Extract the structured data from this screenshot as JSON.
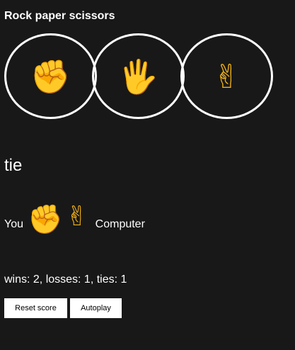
{
  "app": {
    "title": "Rock paper scissors"
  },
  "moves": {
    "rock_icon": "✊",
    "paper_icon": "🖐",
    "scissors_icon": "✌"
  },
  "result": {
    "text": "tie"
  },
  "round": {
    "player_label": "You",
    "player_move_icon": "✊",
    "computer_move_icon": "✌",
    "computer_label": "Computer"
  },
  "score": {
    "text": "wins: 2, losses: 1, ties: 1"
  },
  "buttons": {
    "reset_label": "Reset score",
    "autoplay_label": "Autoplay"
  },
  "colors": {
    "background": "#181818",
    "text": "#ffffff",
    "emoji_yellow": "#f2b21b",
    "button_background": "#ffffff",
    "button_text": "#000000"
  }
}
